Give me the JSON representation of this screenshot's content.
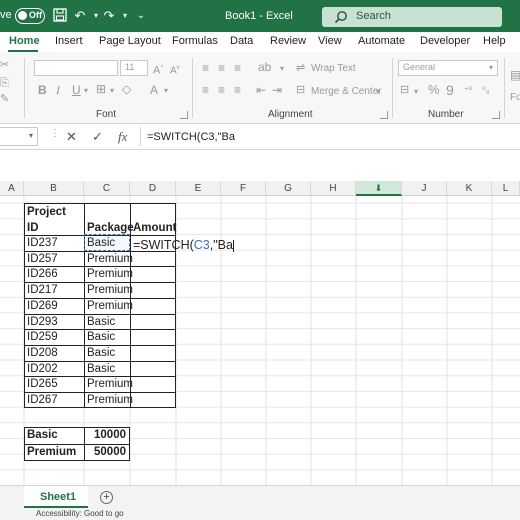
{
  "titlebar": {
    "autosave_fragment": "ve",
    "toggle_text": "Off",
    "doc_title": "Book1 - Excel",
    "search_placeholder": "Search"
  },
  "tabs": [
    "Home",
    "Insert",
    "Page Layout",
    "Formulas",
    "Data",
    "Review",
    "View",
    "Automate",
    "Developer",
    "Help"
  ],
  "ribbon": {
    "font_size_value": "11",
    "number_format_value": "General",
    "wrap_text": "Wrap Text",
    "merge_center": "Merge & Center",
    "group_font": "Font",
    "group_alignment": "Alignment",
    "group_number": "Number",
    "partial_right": "Fo"
  },
  "formula_bar": {
    "cancel": "✕",
    "enter": "✓",
    "fx": "fx",
    "formula": "=SWITCH(C3,\"Ba"
  },
  "columns": [
    "A",
    "B",
    "C",
    "D",
    "E",
    "F",
    "G",
    "H",
    "I",
    "J",
    "K",
    "L"
  ],
  "selected_column": "I",
  "table": {
    "header": {
      "project_line1": "Project",
      "project_line2": "ID",
      "package": "Package",
      "amount": "Amount"
    },
    "rows": [
      {
        "id": "ID237",
        "package": "Basic"
      },
      {
        "id": "ID257",
        "package": "Premium"
      },
      {
        "id": "ID266",
        "package": "Premium"
      },
      {
        "id": "ID217",
        "package": "Premium"
      },
      {
        "id": "ID269",
        "package": "Premium"
      },
      {
        "id": "ID293",
        "package": "Basic"
      },
      {
        "id": "ID259",
        "package": "Basic"
      },
      {
        "id": "ID208",
        "package": "Basic"
      },
      {
        "id": "ID202",
        "package": "Basic"
      },
      {
        "id": "ID265",
        "package": "Premium"
      },
      {
        "id": "ID267",
        "package": "Premium"
      }
    ],
    "editing_formula": {
      "part1": "=SWITCH(",
      "ref": "C3",
      "part2": ",\"Ba"
    }
  },
  "lookup": [
    {
      "label": "Basic",
      "value": "10000"
    },
    {
      "label": "Premium",
      "value": "50000"
    }
  ],
  "sheet": {
    "tab_name": "Sheet1",
    "add_symbol": "+"
  },
  "status": {
    "text": "Accessibility: Good to go"
  },
  "colors": {
    "excel_green": "#217346",
    "ref_blue": "#3b6fc4"
  }
}
